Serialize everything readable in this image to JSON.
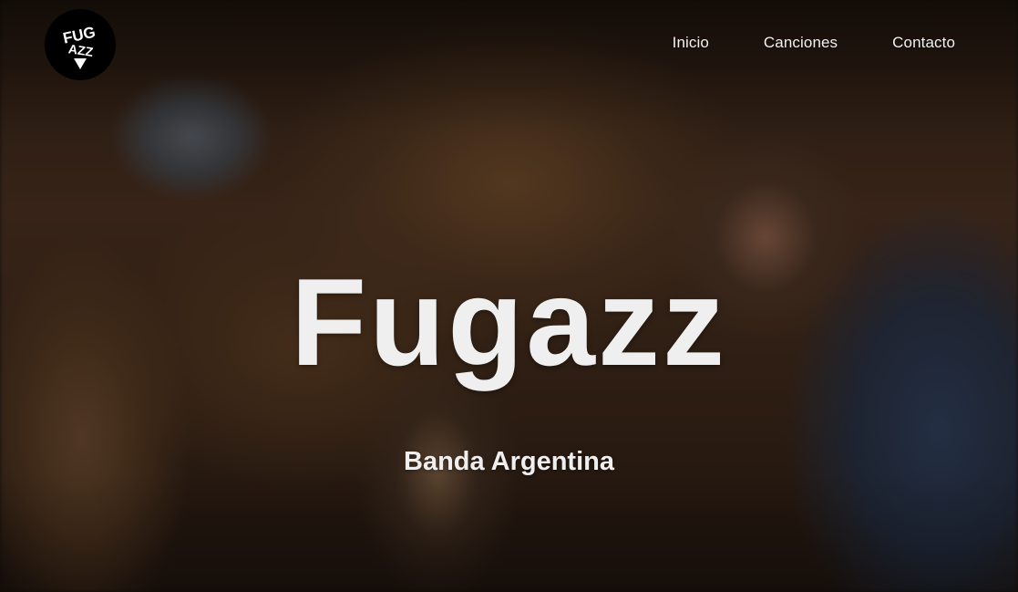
{
  "nav": {
    "logo_text": "FUGAZZ",
    "items": [
      {
        "label": "Inicio"
      },
      {
        "label": "Canciones"
      },
      {
        "label": "Contacto"
      }
    ]
  },
  "hero": {
    "title": "Fugazz",
    "subtitle": "Banda Argentina",
    "background": "band-photo"
  },
  "colors": {
    "text": "#efefef",
    "logo_bg": "#000000"
  }
}
